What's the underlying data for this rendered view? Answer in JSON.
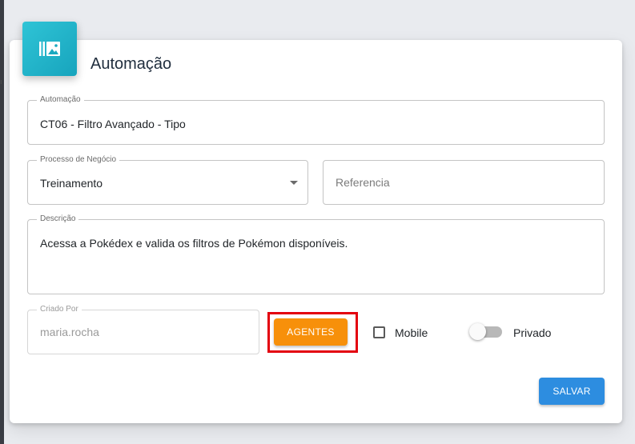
{
  "header": {
    "title": "Automação",
    "icon": "library-images-icon",
    "icon_color": "#1fb3c8"
  },
  "form": {
    "automacao": {
      "label": "Automação",
      "value": "CT06 - Filtro Avançado - Tipo"
    },
    "processo": {
      "label": "Processo de Negócio",
      "value": "Treinamento"
    },
    "referencia": {
      "placeholder": "Referencia"
    },
    "descricao": {
      "label": "Descrição",
      "value": "Acessa a Pokédex e valida os filtros de Pokémon disponíveis."
    },
    "criado_por": {
      "label": "Criado Por",
      "value": "maria.rocha"
    },
    "agentes_button": {
      "label": "AGENTES",
      "color": "#f7900a",
      "highlight_color": "#e3000f"
    },
    "mobile": {
      "label": "Mobile",
      "checked": false
    },
    "privado": {
      "label": "Privado",
      "on": false
    },
    "salvar_button": {
      "label": "SALVAR",
      "color": "#2d8de0"
    }
  }
}
